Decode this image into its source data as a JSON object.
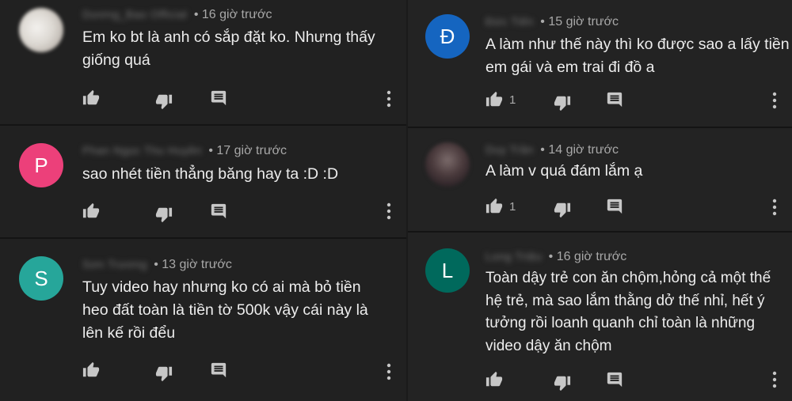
{
  "left_comments": [
    {
      "avatar": {
        "type": "photo",
        "color": "#d9d7d3"
      },
      "author": "Dương_Bao Official",
      "time": "16 giờ trước",
      "text": "Em ko bt là anh có sắp đặt ko. Nhưng thấy\ngiống quá",
      "likes": ""
    },
    {
      "avatar": {
        "type": "letter",
        "letter": "P",
        "color": "#ec407a"
      },
      "author": "Phan Ngọc Thu Huyền",
      "time": "17 giờ trước",
      "text": "sao nhét tiền thẳng băng hay ta :D :D",
      "likes": ""
    },
    {
      "avatar": {
        "type": "letter",
        "letter": "S",
        "color": "#26a69a"
      },
      "author": "Sơn Trương",
      "time": "13 giờ trước",
      "text": "Tuy video hay nhưng ko có ai mà bỏ tiền\nheo đất toàn là tiền tờ 500k vậy cái này là\nlên kế rồi đểu",
      "likes": ""
    }
  ],
  "right_comments": [
    {
      "avatar": {
        "type": "letter",
        "letter": "Đ",
        "color": "#1565c0"
      },
      "author": "Đức Tiến",
      "time": "15 giờ trước",
      "text": "A làm như thế này thì ko được sao a lấy tiền\nem gái và em trai đi đồ a",
      "likes": "1"
    },
    {
      "avatar": {
        "type": "photo",
        "color": "#4a3a3a"
      },
      "author": "Duy Trần",
      "time": "14 giờ trước",
      "text": "A làm v quá đám lắm ạ",
      "likes": "1"
    },
    {
      "avatar": {
        "type": "letter",
        "letter": "L",
        "color": "#00695c"
      },
      "author": "Long Triệu",
      "time": "16 giờ trước",
      "text": "Toàn dậy trẻ con ăn chộm,hỏng cả một thế\nhệ trẻ, mà sao lắm thằng dở thế nhỉ, hết ý\ntưởng rồi loanh quanh chỉ toàn là những\nvideo dậy ăn chộm",
      "likes": ""
    }
  ],
  "icons": {
    "like": "thumb-up-icon",
    "dislike": "thumb-down-icon",
    "reply": "reply-comment-icon",
    "more": "more-vertical-icon"
  },
  "separator": "•"
}
